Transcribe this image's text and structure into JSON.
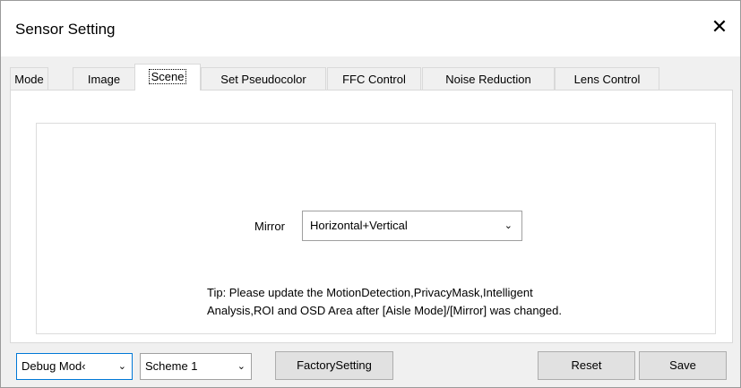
{
  "window": {
    "title": "Sensor Setting",
    "close_glyph": "✕"
  },
  "tabs": [
    {
      "label": "Mode"
    },
    {
      "label": "Image"
    },
    {
      "label": "Scene"
    },
    {
      "label": "Set Pseudocolor"
    },
    {
      "label": "FFC Control"
    },
    {
      "label": "Noise Reduction"
    },
    {
      "label": "Lens Control"
    }
  ],
  "active_tab": "Scene",
  "scene": {
    "mirror_label": "Mirror",
    "mirror_value": "Horizontal+Vertical",
    "tip_line1": "Tip: Please update the MotionDetection,PrivacyMask,Intelligent",
    "tip_line2": "Analysis,ROI and OSD Area after [Aisle Mode]/[Mirror] was changed."
  },
  "footer": {
    "mode_value": "Debug Mod‹",
    "scheme_value": "Scheme 1",
    "factory_label": "FactorySetting",
    "reset_label": "Reset",
    "save_label": "Save"
  },
  "icons": {
    "chevron": "chevron-down-icon",
    "close": "close-icon"
  }
}
